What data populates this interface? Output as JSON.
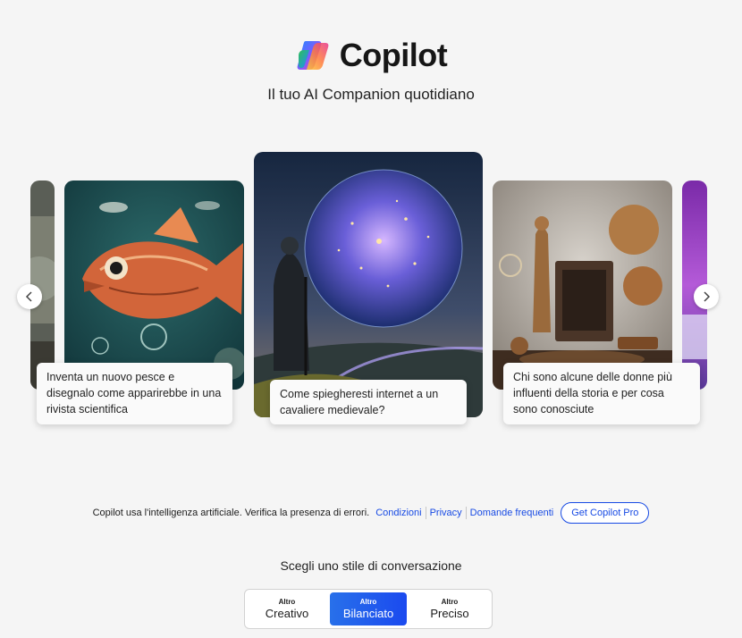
{
  "app": {
    "name": "Copilot",
    "tagline": "Il tuo AI Companion quotidiano"
  },
  "carousel": {
    "cards": [
      {
        "caption": "Inventa un nuovo pesce e disegnalo come apparirebbe in una rivista scientifica"
      },
      {
        "caption": "Come spiegheresti internet a un cavaliere medievale?"
      },
      {
        "caption": "Chi sono alcune delle donne più influenti della storia e per cosa sono conosciute"
      }
    ],
    "prev_icon": "chevron-left-icon",
    "next_icon": "chevron-right-icon"
  },
  "footer": {
    "disclaimer": "Copilot usa l'intelligenza artificiale. Verifica la presenza di errori.",
    "links": [
      "Condizioni",
      "Privacy",
      "Domande frequenti"
    ],
    "pro_button": "Get Copilot Pro"
  },
  "conversation_style": {
    "title": "Scegli uno stile di conversazione",
    "options": [
      {
        "small": "Altro",
        "label": "Creativo",
        "selected": false
      },
      {
        "small": "Altro",
        "label": "Bilanciato",
        "selected": true
      },
      {
        "small": "Altro",
        "label": "Preciso",
        "selected": false
      }
    ]
  },
  "colors": {
    "accent": "#174ae4",
    "selected_gradient_start": "#2870ea",
    "selected_gradient_end": "#1b4aef",
    "background": "#f5f5f5"
  }
}
